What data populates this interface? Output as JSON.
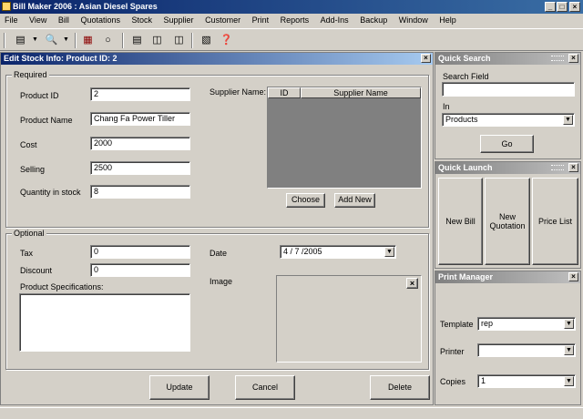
{
  "app": {
    "title": "Bill Maker 2006 : Asian Diesel Spares"
  },
  "window_controls": {
    "minimize": "_",
    "maximize": "□",
    "close": "×"
  },
  "menu": [
    "File",
    "View",
    "Bill",
    "Quotations",
    "Stock",
    "Supplier",
    "Customer",
    "Print",
    "Reports",
    "Add-Ins",
    "Backup",
    "Window",
    "Help"
  ],
  "toolbar": {
    "icons": [
      "list-view-icon",
      "dropdown-icon",
      "search-icon",
      "dropdown-icon",
      "bill-book-icon",
      "disc-icon",
      "document-icon",
      "copy-documents-icon",
      "print-documents-icon",
      "tools-icon",
      "help-icon"
    ]
  },
  "editor": {
    "title": "Edit Stock Info: Product ID: 2",
    "required_label": "Required",
    "optional_label": "Optional",
    "fields": {
      "product_id": {
        "label": "Product ID",
        "value": "2"
      },
      "product_name": {
        "label": "Product Name",
        "value": "Chang Fa Power Tiller"
      },
      "cost": {
        "label": "Cost",
        "value": "2000"
      },
      "selling": {
        "label": "Selling",
        "value": "2500"
      },
      "quantity": {
        "label": "Quantity in stock",
        "value": "8"
      },
      "tax": {
        "label": "Tax",
        "value": "0"
      },
      "discount": {
        "label": "Discount",
        "value": "0"
      },
      "specs": {
        "label": "Product Specifications:",
        "value": ""
      },
      "date": {
        "label": "Date",
        "value": "4 / 7 /2005"
      },
      "image": {
        "label": "Image"
      }
    },
    "supplier": {
      "label": "Supplier Name:",
      "columns": [
        "ID",
        "Supplier Name"
      ],
      "choose_label": "Choose",
      "add_new_label": "Add New"
    },
    "actions": {
      "update": "Update",
      "cancel": "Cancel",
      "delete": "Delete"
    }
  },
  "quick_search": {
    "title": "Quick Search",
    "field_label": "Search Field",
    "field_value": "",
    "in_label": "In",
    "in_value": "Products",
    "go_label": "Go"
  },
  "quick_launch": {
    "title": "Quick Launch",
    "buttons": [
      "New Bill",
      "New Quotation",
      "Price List"
    ]
  },
  "print_manager": {
    "title": "Print Manager",
    "template_label": "Template",
    "template_value": "rep",
    "printer_label": "Printer",
    "printer_value": "",
    "copies_label": "Copies",
    "copies_value": "1"
  }
}
